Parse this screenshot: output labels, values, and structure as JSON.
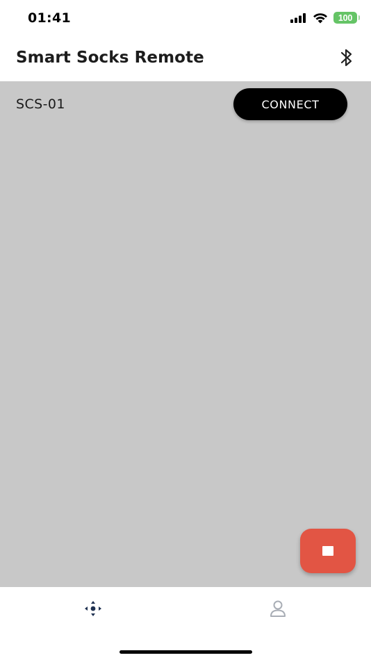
{
  "status_bar": {
    "time": "01:41",
    "battery_level": "100",
    "signal_icon": "cellular-signal-icon",
    "wifi_icon": "wifi-icon",
    "battery_color": "#65c466"
  },
  "header": {
    "title": "Smart Socks Remote",
    "bluetooth_icon": "bluetooth-icon"
  },
  "device_list": [
    {
      "name": "SCS-01",
      "action_label": "CONNECT"
    }
  ],
  "fab": {
    "icon": "stop-icon",
    "color": "#e25544"
  },
  "bottom_nav": {
    "items": [
      {
        "icon": "remote-control-icon",
        "active": true
      },
      {
        "icon": "profile-icon",
        "active": false
      }
    ],
    "active_color": "#1e3050",
    "inactive_color": "#a8adb5"
  },
  "colors": {
    "content_background": "#c8c8c8",
    "connect_button": "#000000"
  }
}
